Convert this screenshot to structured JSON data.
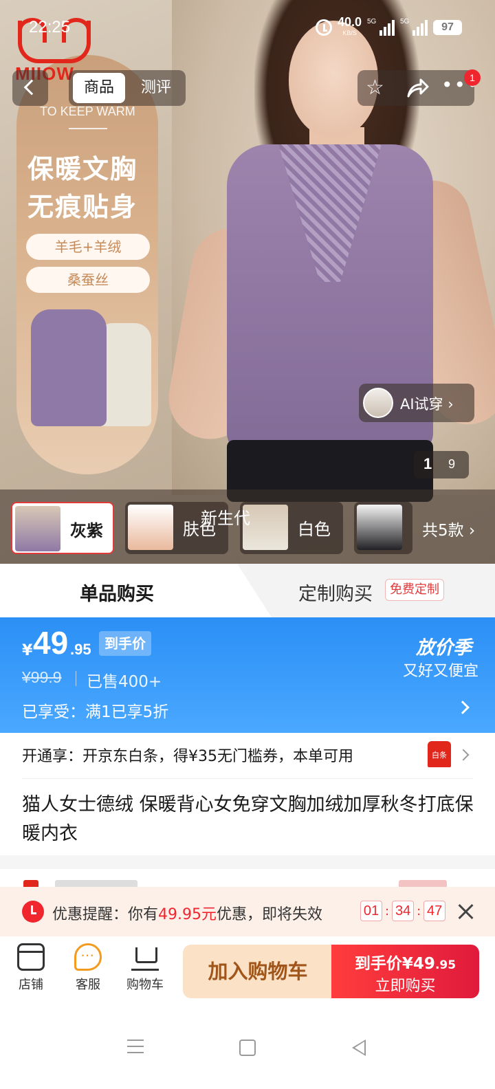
{
  "status_bar": {
    "time": "22:25",
    "net_speed_value": "40.0",
    "net_speed_unit": "KB/S",
    "signal1_tag": "5G",
    "signal2_tag": "5G",
    "battery": "97"
  },
  "brand": {
    "logo_text": "MIIOW"
  },
  "top_nav": {
    "tab_goods": "商品",
    "tab_review": "测评",
    "notification_count": "1"
  },
  "hero": {
    "slogan_en": "TO KEEP WARM",
    "slogan_line1": "保暖文胸",
    "slogan_line2": "无痕贴身",
    "pill1": "羊毛+羊绒",
    "pill2": "桑蚕丝",
    "ai_try_label": "AI试穿 ›",
    "page_current": "1",
    "page_total": "9",
    "floating_tag": "新生代"
  },
  "variants": {
    "items": [
      {
        "label": "灰紫",
        "color": "#8f79a6"
      },
      {
        "label": "肤色",
        "color": "#e9b99d"
      },
      {
        "label": "白色",
        "color": "#eae6dc"
      },
      {
        "label": "",
        "color": "#222226"
      }
    ],
    "more_label": "共5款 ›"
  },
  "purchase_mode": {
    "single": "单品购买",
    "custom": "定制购买",
    "custom_tag": "免费定制"
  },
  "price": {
    "currency": "¥",
    "integer": "49",
    "decimal": ".95",
    "tag": "到手价",
    "original": "¥99.9",
    "sold": "已售400+",
    "season_title": "放价季",
    "season_sub": "又好又便宜",
    "discount": "已享受：满1已享5折"
  },
  "jd_row": {
    "text": "开通享：开京东白条，得¥35无门槛券，本单可用",
    "icon_text": "白条"
  },
  "product": {
    "title": "猫人女士德绒 保暖背心女免穿文胸加绒加厚秋冬打底保暖内衣"
  },
  "reminder": {
    "prefix": "优惠提醒：你有",
    "amount": "49.95元",
    "suffix": "优惠，即将失效",
    "hours": "01",
    "minutes": "34",
    "seconds": "47"
  },
  "bottom_bar": {
    "shop": "店铺",
    "service": "客服",
    "cart": "购物车",
    "add_to_cart": "加入购物车",
    "buy_price_prefix": "到手价¥49",
    "buy_price_decimal": ".95",
    "buy_now": "立即购买"
  },
  "colors": {
    "price_panel": "#2b8ff5",
    "accent_red": "#f0262f",
    "add_cart_bg": "#fbe1c6"
  }
}
